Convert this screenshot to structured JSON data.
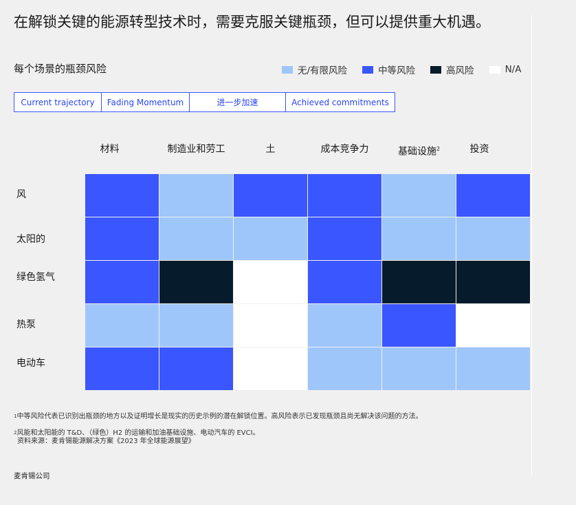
{
  "title": "在解锁关键的能源转型技术时，需要克服关键瓶颈，但可以提供重大机遇。",
  "subtitle": "每个场景的瓶颈风险",
  "legend": [
    {
      "label": "无/有限风险",
      "color": "#9ec6fb"
    },
    {
      "label": "中等风险",
      "color": "#3a56ff"
    },
    {
      "label": "高风险",
      "color": "#061b2b"
    },
    {
      "label": "N/A",
      "color": "#ffffff"
    }
  ],
  "tabs": [
    {
      "label": "Current trajectory",
      "active": false
    },
    {
      "label": "Fading Momentum",
      "active": false
    },
    {
      "label": "进一步加速",
      "active": true
    },
    {
      "label": "Achieved commitments",
      "active": false
    }
  ],
  "chart_data": {
    "type": "heatmap",
    "columns": [
      "材料",
      "制造业和劳工",
      "土",
      "成本竞争力",
      "基础设施",
      "投资"
    ],
    "column_footnote": {
      "4": "2"
    },
    "rows": [
      "风",
      "太阳的",
      "绿色氢气",
      "热泵",
      "电动车"
    ],
    "levels": [
      "无/有限风险",
      "中等风险",
      "高风险",
      "N/A"
    ],
    "values": [
      [
        "中等风险",
        "无/有限风险",
        "中等风险",
        "中等风险",
        "无/有限风险",
        "中等风险"
      ],
      [
        "中等风险",
        "无/有限风险",
        "无/有限风险",
        "中等风险",
        "无/有限风险",
        "无/有限风险"
      ],
      [
        "中等风险",
        "高风险",
        "N/A",
        "中等风险",
        "高风险",
        "高风险"
      ],
      [
        "无/有限风险",
        "无/有限风险",
        "N/A",
        "无/有限风险",
        "中等风险",
        "N/A"
      ],
      [
        "中等风险",
        "中等风险",
        "N/A",
        "无/有限风险",
        "无/有限风险",
        "无/有限风险"
      ]
    ]
  },
  "notes": {
    "note1_mark": "1",
    "note1": "中等风险代表已识别出瓶颈的地方以及证明增长是现实的历史示例的潜在解锁位置。高风险表示已发现瓶颈且尚无解决该问题的方法。",
    "note2_mark": "2",
    "note2": "风能和太阳能的 T&D、（绿色）H2 的运输和加油基础设施、电动汽车的 EVCI。",
    "source_line": "资料来源：麦肯锡能源解决方案《2023 年全球能源展望》"
  },
  "source": "麦肯锡公司"
}
